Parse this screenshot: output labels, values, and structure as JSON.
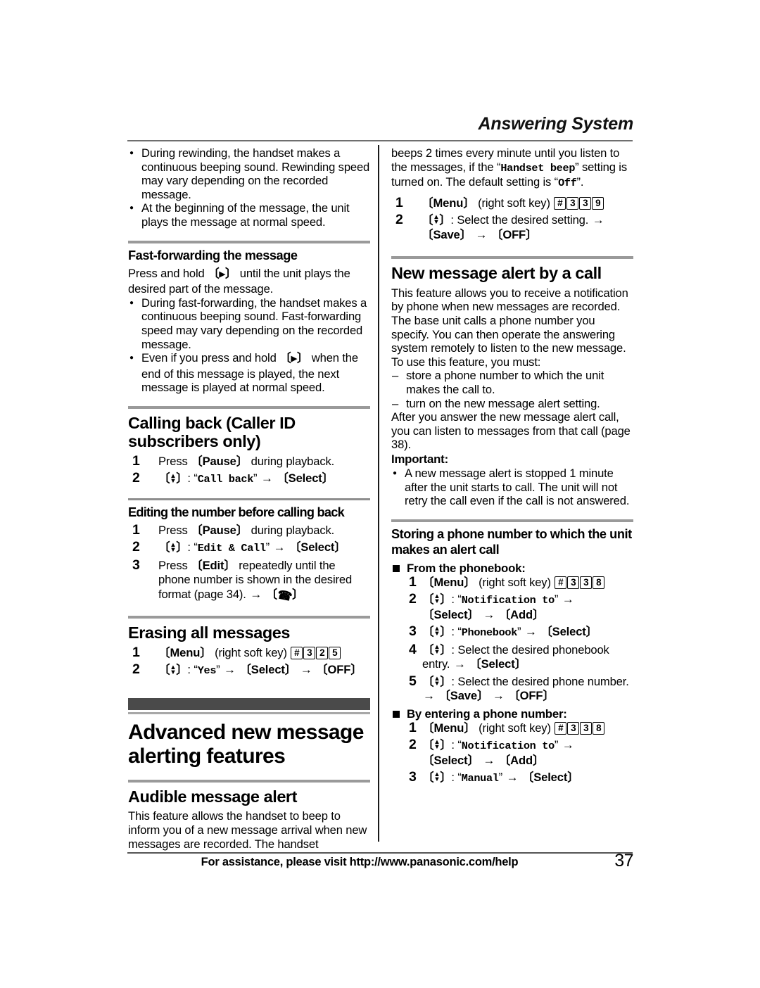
{
  "header": {
    "running_head": "Answering System"
  },
  "footer": {
    "assistance": "For assistance, please visit http://www.panasonic.com/help",
    "page_number": "37"
  },
  "left_column": {
    "top_bullets": [
      "During rewinding, the handset makes a continuous beeping sound. Rewinding speed may vary depending on the recorded message.",
      "At the beginning of the message, the unit plays the message at normal speed."
    ],
    "fast_forward": {
      "title": "Fast-forwarding the message",
      "intro_prefix": "Press and hold ",
      "intro_key": "▶",
      "intro_suffix": " until the unit plays the desired part of the message.",
      "bullets": [
        "During fast-forwarding, the handset makes a continuous beeping sound. Fast-forwarding speed may vary depending on the recorded message.",
        {
          "before": "Even if you press and hold ",
          "key": "▶",
          "after": " when the end of this message is played, the next message is played at normal speed."
        }
      ]
    },
    "calling_back": {
      "title": "Calling back (Caller ID subscribers only)",
      "steps": [
        {
          "text_before": "Press ",
          "key": "Pause",
          "text_after": " during playback."
        },
        {
          "nav": true,
          "quoted": "Call back",
          "then": "Select"
        }
      ]
    },
    "editing_number": {
      "title": "Editing the number before calling back",
      "steps": [
        {
          "text_before": "Press ",
          "key": "Pause",
          "text_after": " during playback."
        },
        {
          "nav": true,
          "quoted": "Edit & Call",
          "then": "Select"
        },
        {
          "text_before": "Press ",
          "key": "Edit",
          "text_after": " repeatedly until the phone number is shown in the desired format (page 34).",
          "end_icon": "talk-icon"
        }
      ]
    },
    "erasing": {
      "title": "Erasing all messages",
      "steps": [
        {
          "key": "Menu",
          "note": "(right soft key)",
          "keycaps": [
            "#",
            "3",
            "2",
            "5"
          ]
        },
        {
          "nav": true,
          "quoted": "Yes",
          "then": "Select",
          "then2": "OFF"
        }
      ]
    },
    "chapter": {
      "title": "Advanced new message alerting features"
    },
    "audible_alert": {
      "title": "Audible message alert",
      "body": "This feature allows the handset to beep to inform you of a new message arrival when new messages are recorded. The handset"
    }
  },
  "right_column": {
    "continued": {
      "seg1": "beeps 2 times every minute until you listen to the messages, if the ",
      "mono1": "Handset beep",
      "seg2": " setting is turned on. The default setting is ",
      "mono2": "Off",
      "seg3": "."
    },
    "continued_steps": [
      {
        "key": "Menu",
        "note": "(right soft key)",
        "keycaps": [
          "#",
          "3",
          "3",
          "9"
        ]
      },
      {
        "nav": true,
        "plain": "Select the desired setting.",
        "then": "Save",
        "then2": "OFF"
      }
    ],
    "new_message_alert": {
      "title": "New message alert by a call",
      "body": "This feature allows you to receive a notification by phone when new messages are recorded. The base unit calls a phone number you specify. You can then operate the answering system remotely to listen to the new message.",
      "use_intro": "To use this feature, you must:",
      "dashes": [
        "store a phone number to which the unit makes the call to.",
        "turn on the new message alert setting."
      ],
      "after": "After you answer the new message alert call, you can listen to messages from that call (page 38).",
      "important_label": "Important:",
      "important_bullets": [
        "A new message alert is stopped 1 minute after the unit starts to call. The unit will not retry the call even if the call is not answered."
      ]
    },
    "storing": {
      "title": "Storing a phone number to which the unit makes an alert call",
      "from_phonebook": {
        "label": "From the phonebook:",
        "steps": [
          {
            "key": "Menu",
            "note": "(right soft key)",
            "keycaps": [
              "#",
              "3",
              "3",
              "8"
            ]
          },
          {
            "nav": true,
            "quoted": "Notification to",
            "then": "Select",
            "then2": "Add"
          },
          {
            "nav": true,
            "quoted": "Phonebook",
            "then": "Select"
          },
          {
            "nav": true,
            "plain": "Select the desired phonebook entry.",
            "then": "Select"
          },
          {
            "nav": true,
            "plain": "Select the desired phone number.",
            "then": "Save",
            "then2": "OFF"
          }
        ]
      },
      "by_entering": {
        "label": "By entering a phone number:",
        "steps": [
          {
            "key": "Menu",
            "note": "(right soft key)",
            "keycaps": [
              "#",
              "3",
              "3",
              "8"
            ]
          },
          {
            "nav": true,
            "quoted": "Notification to",
            "then": "Select",
            "then2": "Add"
          },
          {
            "nav": true,
            "quoted": "Manual",
            "then": "Select"
          }
        ]
      }
    }
  }
}
